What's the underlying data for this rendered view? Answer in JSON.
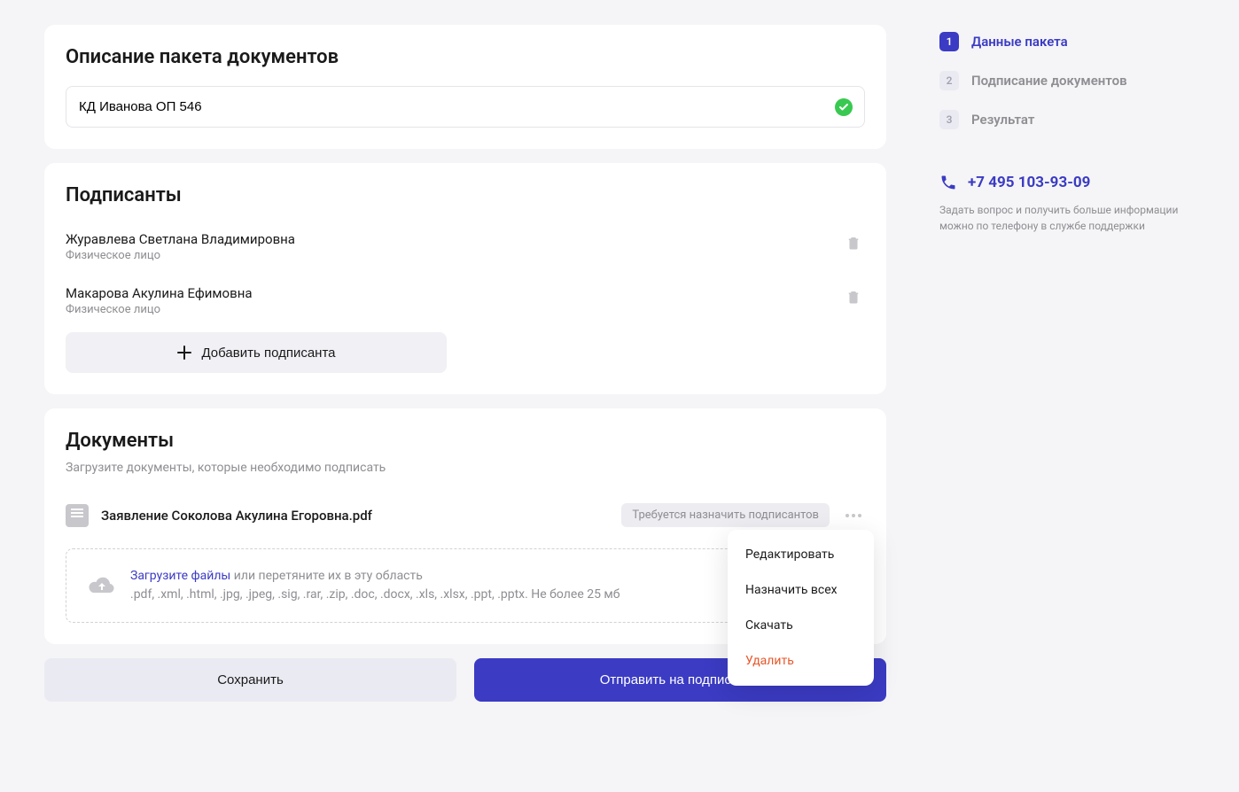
{
  "description": {
    "title": "Описание пакета документов",
    "value": "КД Иванова ОП 546"
  },
  "signers": {
    "title": "Подписанты",
    "add_label": "Добавить подписанта",
    "items": [
      {
        "name": "Журавлева Светлана Владимировна",
        "type": "Физическое лицо"
      },
      {
        "name": "Макарова Акулина Ефимовна",
        "type": "Физическое лицо"
      }
    ]
  },
  "documents": {
    "title": "Документы",
    "subtitle": "Загрузите документы, которые необходимо подписать",
    "file_name": "Заявление Соколова Акулина Егоровна.pdf",
    "badge": "Требуется назначить подписантов",
    "upload_link": "Загрузите файлы",
    "upload_hint": " или перетяните их в эту область",
    "upload_formats": ".pdf, .xml, .html, .jpg, .jpeg, .sig, .rar, .zip, .doc, .docx, .xls, .xlsx, .ppt, .pptx. Не более 25 мб"
  },
  "dropdown": {
    "edit": "Редактировать",
    "assign_all": "Назначить всех",
    "download": "Скачать",
    "delete": "Удалить"
  },
  "actions": {
    "save": "Сохранить",
    "send": "Отправить на подписание"
  },
  "sidebar": {
    "steps": [
      {
        "num": "1",
        "label": "Данные пакета"
      },
      {
        "num": "2",
        "label": "Подписание документов"
      },
      {
        "num": "3",
        "label": "Результат"
      }
    ],
    "phone": "+7 495 103-93-09",
    "help": "Задать вопрос и получить больше информации можно по телефону в службе поддержки"
  }
}
